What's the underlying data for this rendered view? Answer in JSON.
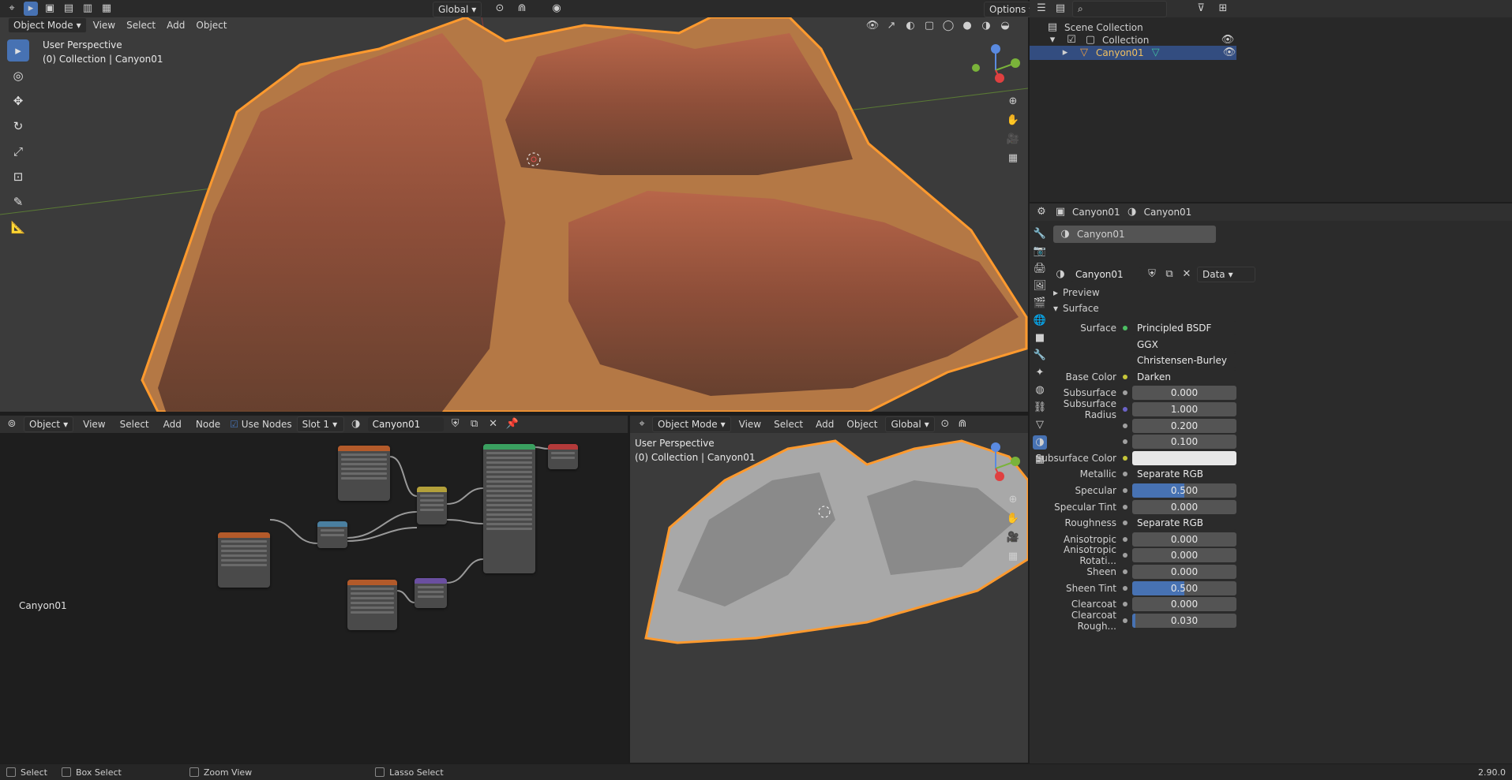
{
  "viewport_top": {
    "mode": "Object Mode",
    "menus": [
      "View",
      "Select",
      "Add",
      "Object"
    ],
    "orientation": "Global",
    "options": "Options",
    "perspective": "User Perspective",
    "collection": "(0) Collection | Canyon01"
  },
  "outliner": {
    "scene_collection": "Scene Collection",
    "collection": "Collection",
    "object": "Canyon01"
  },
  "properties": {
    "header_object": "Canyon01",
    "header_material": "Canyon01",
    "slot_name": "Canyon01",
    "material_name": "Canyon01",
    "data_mode": "Data",
    "preview": "Preview",
    "surface_panel": "Surface",
    "rows": [
      {
        "label": "Surface",
        "value": "Principled BSDF",
        "kind": "link",
        "dot": "#4cbf63"
      },
      {
        "label": "",
        "value": "GGX",
        "kind": "dd"
      },
      {
        "label": "",
        "value": "Christensen-Burley",
        "kind": "dd"
      },
      {
        "label": "Base Color",
        "value": "Darken",
        "kind": "link",
        "dot": "#c7c73a",
        "arrow": true
      },
      {
        "label": "Subsurface",
        "value": "0.000",
        "kind": "num",
        "fill": 0
      },
      {
        "label": "Subsurface Radius",
        "value": "1.000",
        "kind": "num",
        "fill": 0,
        "dot": "#6b63c7"
      },
      {
        "label": "",
        "value": "0.200",
        "kind": "num",
        "fill": 0
      },
      {
        "label": "",
        "value": "0.100",
        "kind": "num",
        "fill": 0
      },
      {
        "label": "Subsurface Color",
        "value": "",
        "kind": "color",
        "dot": "#c7c73a"
      },
      {
        "label": "Metallic",
        "value": "Separate RGB",
        "kind": "link",
        "arrow": true
      },
      {
        "label": "Specular",
        "value": "0.500",
        "kind": "num",
        "fill": 0.5
      },
      {
        "label": "Specular Tint",
        "value": "0.000",
        "kind": "num",
        "fill": 0
      },
      {
        "label": "Roughness",
        "value": "Separate RGB",
        "kind": "link",
        "arrow": true
      },
      {
        "label": "Anisotropic",
        "value": "0.000",
        "kind": "num",
        "fill": 0
      },
      {
        "label": "Anisotropic Rotati...",
        "value": "0.000",
        "kind": "num",
        "fill": 0
      },
      {
        "label": "Sheen",
        "value": "0.000",
        "kind": "num",
        "fill": 0
      },
      {
        "label": "Sheen Tint",
        "value": "0.500",
        "kind": "num",
        "fill": 0.5
      },
      {
        "label": "Clearcoat",
        "value": "0.000",
        "kind": "num",
        "fill": 0
      },
      {
        "label": "Clearcoat Rough...",
        "value": "0.030",
        "kind": "num",
        "fill": 0.03
      }
    ]
  },
  "node_editor": {
    "type": "Object",
    "menus": [
      "View",
      "Select",
      "Add",
      "Node"
    ],
    "use_nodes": "Use Nodes",
    "slot": "Slot 1",
    "material": "Canyon01",
    "label": "Canyon01"
  },
  "viewport_bottom": {
    "mode": "Object Mode",
    "menus": [
      "View",
      "Select",
      "Add",
      "Object"
    ],
    "orientation": "Global",
    "perspective": "User Perspective",
    "collection": "(0) Collection | Canyon01"
  },
  "statusbar": {
    "select": "Select",
    "box_select": "Box Select",
    "zoom_view": "Zoom View",
    "lasso_select": "Lasso Select",
    "version": "2.90.0"
  }
}
